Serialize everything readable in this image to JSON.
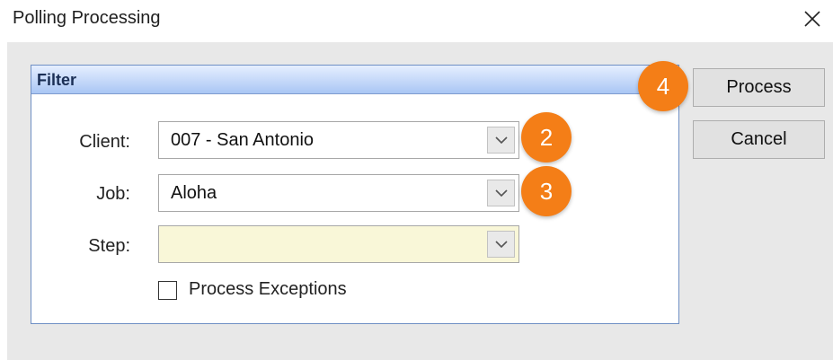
{
  "window": {
    "title": "Polling Processing"
  },
  "filter": {
    "title": "Filter",
    "client_label": "Client:",
    "client_value": "007 - San Antonio",
    "job_label": "Job:",
    "job_value": "Aloha",
    "step_label": "Step:",
    "step_value": "",
    "process_exceptions_label": "Process Exceptions",
    "process_exceptions_checked": false
  },
  "buttons": {
    "process": "Process",
    "cancel": "Cancel"
  },
  "callouts": [
    "2",
    "3",
    "4"
  ],
  "colors": {
    "callout": "#f47e17",
    "step_field_bg": "#f9f7d8",
    "group_header": "#a9c6f4"
  },
  "icons": {
    "close": "close-icon",
    "dropdown": "chevron-down-icon"
  }
}
